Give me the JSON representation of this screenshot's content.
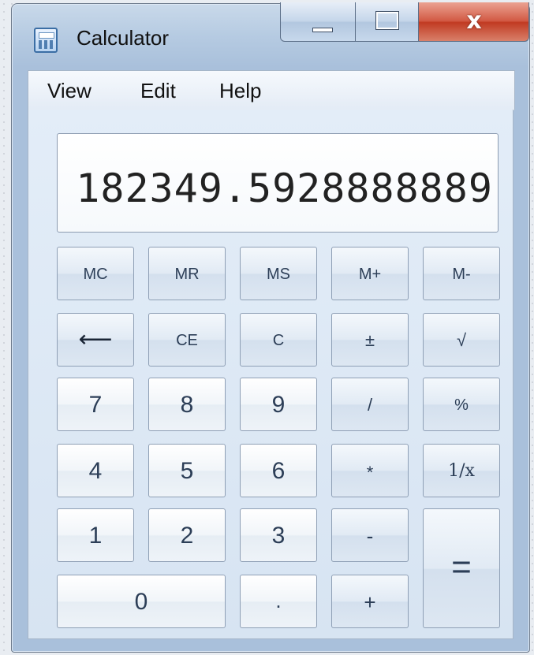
{
  "window": {
    "title": "Calculator",
    "close_glyph": "x"
  },
  "menu": [
    "View",
    "Edit",
    "Help"
  ],
  "display": {
    "value": "182349.5928888889"
  },
  "keys": {
    "mc": "MC",
    "mr": "MR",
    "ms": "MS",
    "mplus": "M+",
    "mminus": "M-",
    "backspace": "⟵",
    "ce": "CE",
    "c": "C",
    "plusminus": "±",
    "sqrt": "√",
    "k7": "7",
    "k8": "8",
    "k9": "9",
    "divide": "/",
    "percent": "%",
    "k4": "4",
    "k5": "5",
    "k6": "6",
    "multiply": "*",
    "reciprocal": "1/x",
    "k1": "1",
    "k2": "2",
    "k3": "3",
    "minus": "-",
    "k0": "0",
    "decimal": ".",
    "plus": "+",
    "equals": "="
  }
}
